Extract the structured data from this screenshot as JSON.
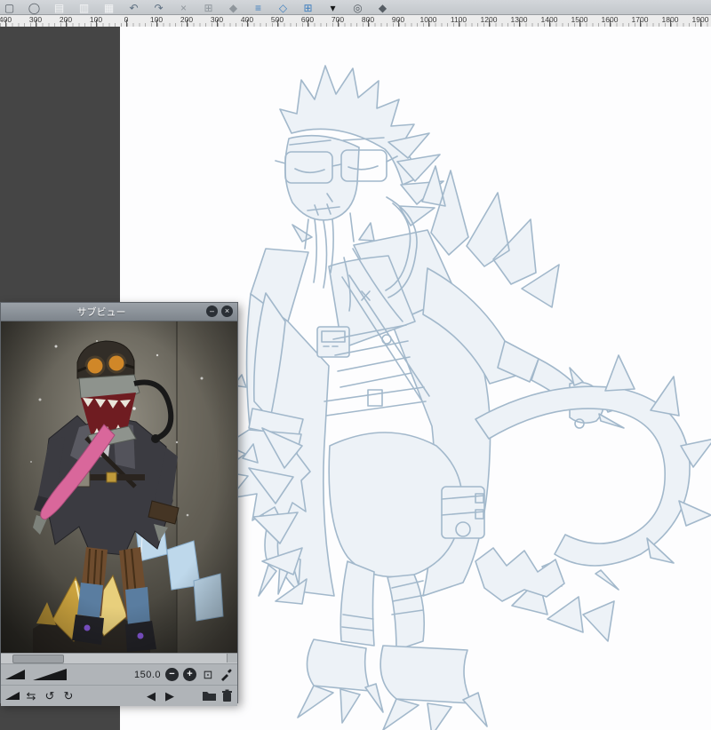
{
  "toolbar": {
    "icons": [
      {
        "name": "object-tool-icon",
        "glyph": "▢",
        "color": "#565d64"
      },
      {
        "name": "rotate-view-icon",
        "glyph": "◯",
        "color": "#565d64"
      },
      {
        "name": "new-canvas-icon",
        "glyph": "▤",
        "color": "#f4f5f6"
      },
      {
        "name": "open-file-icon",
        "glyph": "▥",
        "color": "#f4f5f6"
      },
      {
        "name": "save-file-icon",
        "glyph": "▦",
        "color": "#f4f5f6"
      },
      {
        "name": "undo-icon",
        "glyph": "↶",
        "color": "#5e7082"
      },
      {
        "name": "redo-icon",
        "glyph": "↷",
        "color": "#5e7082"
      },
      {
        "name": "delete-icon",
        "glyph": "×",
        "color": "#8f969c"
      },
      {
        "name": "copy-icon",
        "glyph": "⊞",
        "color": "#8f969c"
      },
      {
        "name": "fill-icon",
        "glyph": "◆",
        "color": "#8f969c"
      },
      {
        "name": "snap-ruler-icon",
        "glyph": "≡",
        "color": "#3f7fbf"
      },
      {
        "name": "snap-special-ruler-icon",
        "glyph": "◇",
        "color": "#3f7fbf"
      },
      {
        "name": "snap-grid-icon",
        "glyph": "⊞",
        "color": "#3f7fbf"
      },
      {
        "name": "ruler-dropdown-icon",
        "glyph": "▾",
        "color": "#16181a"
      },
      {
        "name": "compass-icon",
        "glyph": "◎",
        "color": "#565d64"
      },
      {
        "name": "settings-icon",
        "glyph": "◆",
        "color": "#565d64"
      }
    ]
  },
  "ruler": {
    "labels": [
      "400",
      "300",
      "200",
      "100",
      "0",
      "100",
      "200",
      "300",
      "400",
      "500",
      "600",
      "700",
      "800",
      "900",
      "1000",
      "1100",
      "1200",
      "1300",
      "1400",
      "1500",
      "1600",
      "1700",
      "1800",
      "1900"
    ]
  },
  "subview": {
    "title": "サブビュー",
    "minimize_glyph": "–",
    "close_glyph": "×",
    "zoom_value": "150.0",
    "zoom_out_glyph": "−",
    "zoom_in_glyph": "+",
    "fit_glyph": "⊡",
    "flip_glyph": "⇆",
    "rotate_ccw_glyph": "↺",
    "rotate_cw_glyph": "↻",
    "prev_glyph": "◀",
    "next_glyph": "▶"
  },
  "colors": {
    "toolbar_accent_blue": "#3f7fbf",
    "pasteboard": "#454545",
    "sketch_line": "#a2b8cb",
    "canvas": "#fdfdfe"
  }
}
